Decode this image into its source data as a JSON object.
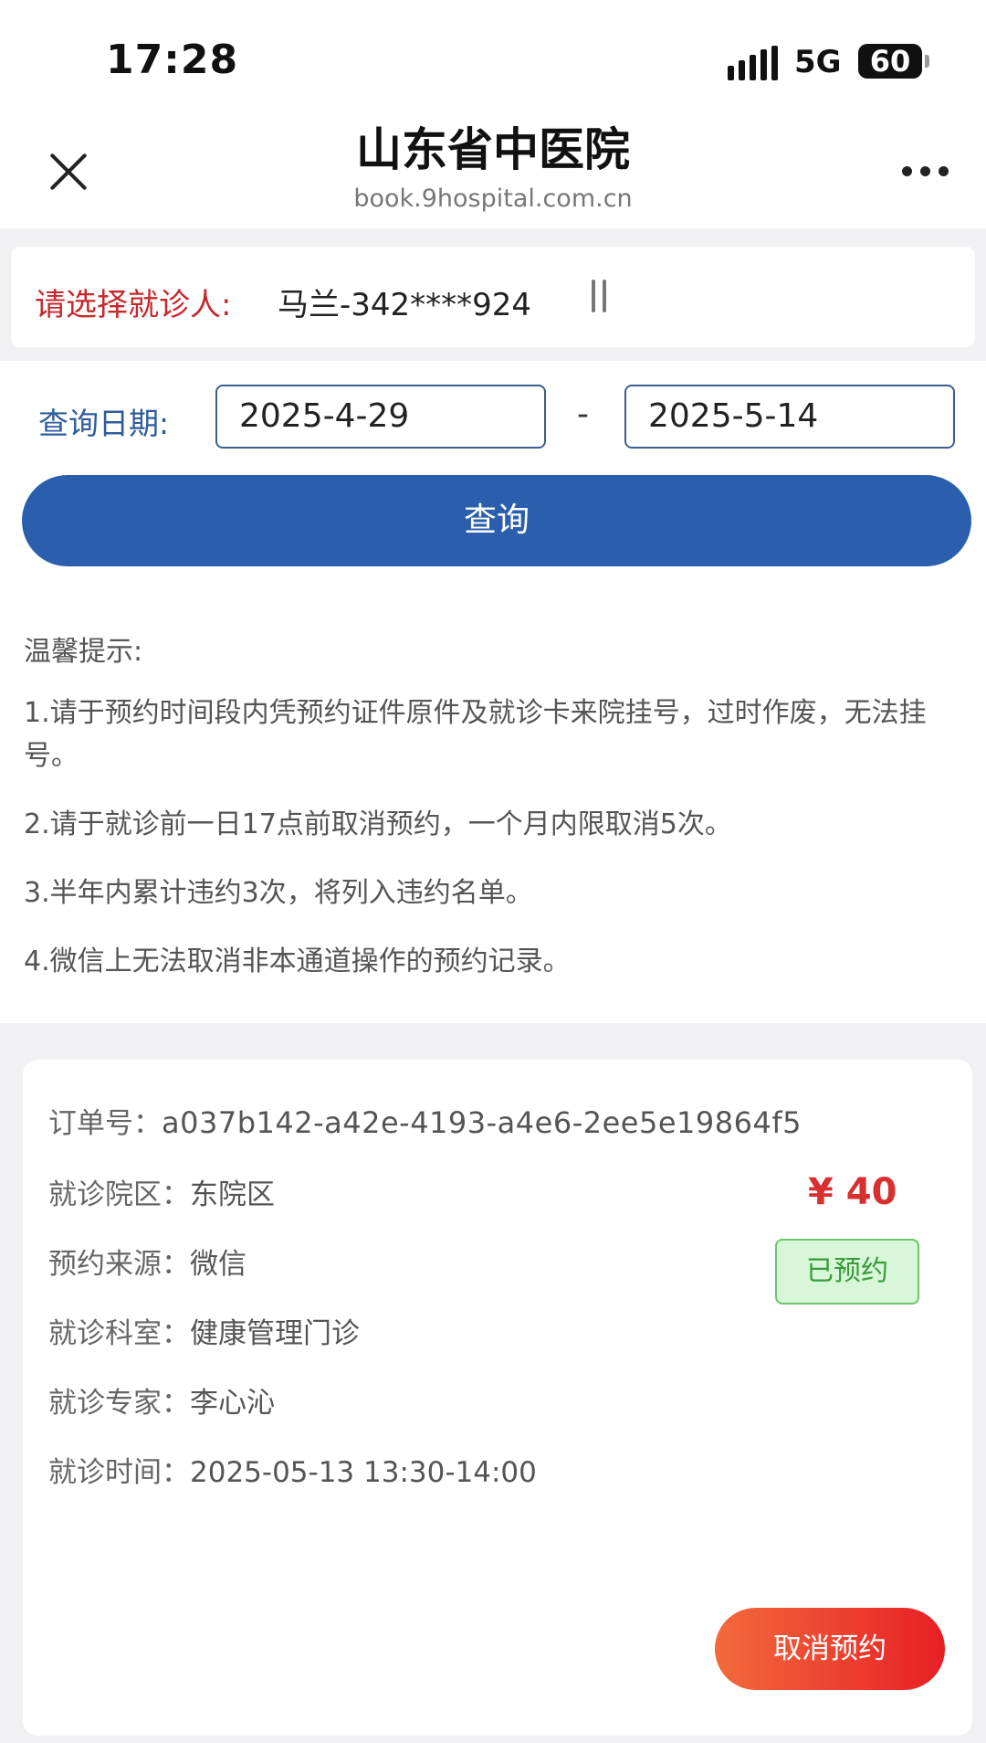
{
  "status_bar": {
    "time": "17:28",
    "network": "5G",
    "battery": "60"
  },
  "header": {
    "title": "山东省中医院",
    "url": "book.9hospital.com.cn"
  },
  "patient": {
    "label": "请选择就诊人:",
    "value": "马兰-342****924"
  },
  "date_query": {
    "label": "查询日期:",
    "start": "2025-4-29",
    "separator": "-",
    "end": "2025-5-14",
    "button": "查询"
  },
  "tips": {
    "title": "温馨提示:",
    "items": [
      "1.请于预约时间段内凭预约证件原件及就诊卡来院挂号，过时作废，无法挂号。",
      "2.请于就诊前一日17点前取消预约，一个月内限取消5次。",
      "3.半年内累计违约3次，将列入违约名单。",
      "4.微信上无法取消非本通道操作的预约记录。"
    ]
  },
  "order": {
    "fields": [
      {
        "key": "订单号：",
        "value": "a037b142-a42e-4193-a4e6-2ee5e19864f5"
      },
      {
        "key": "就诊院区：",
        "value": "东院区"
      },
      {
        "key": "预约来源：",
        "value": "微信"
      },
      {
        "key": "就诊科室：",
        "value": "健康管理门诊"
      },
      {
        "key": "就诊专家：",
        "value": "李心沁"
      },
      {
        "key": "就诊时间：",
        "value": "2025-05-13 13:30-14:00"
      }
    ],
    "price": "¥ 40",
    "status": "已预约",
    "cancel_button": "取消预约"
  },
  "colors": {
    "accent_blue": "#2b5fad",
    "alert_red": "#c8282b",
    "price_red": "#d8302f",
    "status_green": "#3a9a3a"
  },
  "icons": [
    "close-icon",
    "more-icon",
    "swap-icon",
    "signal-icon"
  ]
}
